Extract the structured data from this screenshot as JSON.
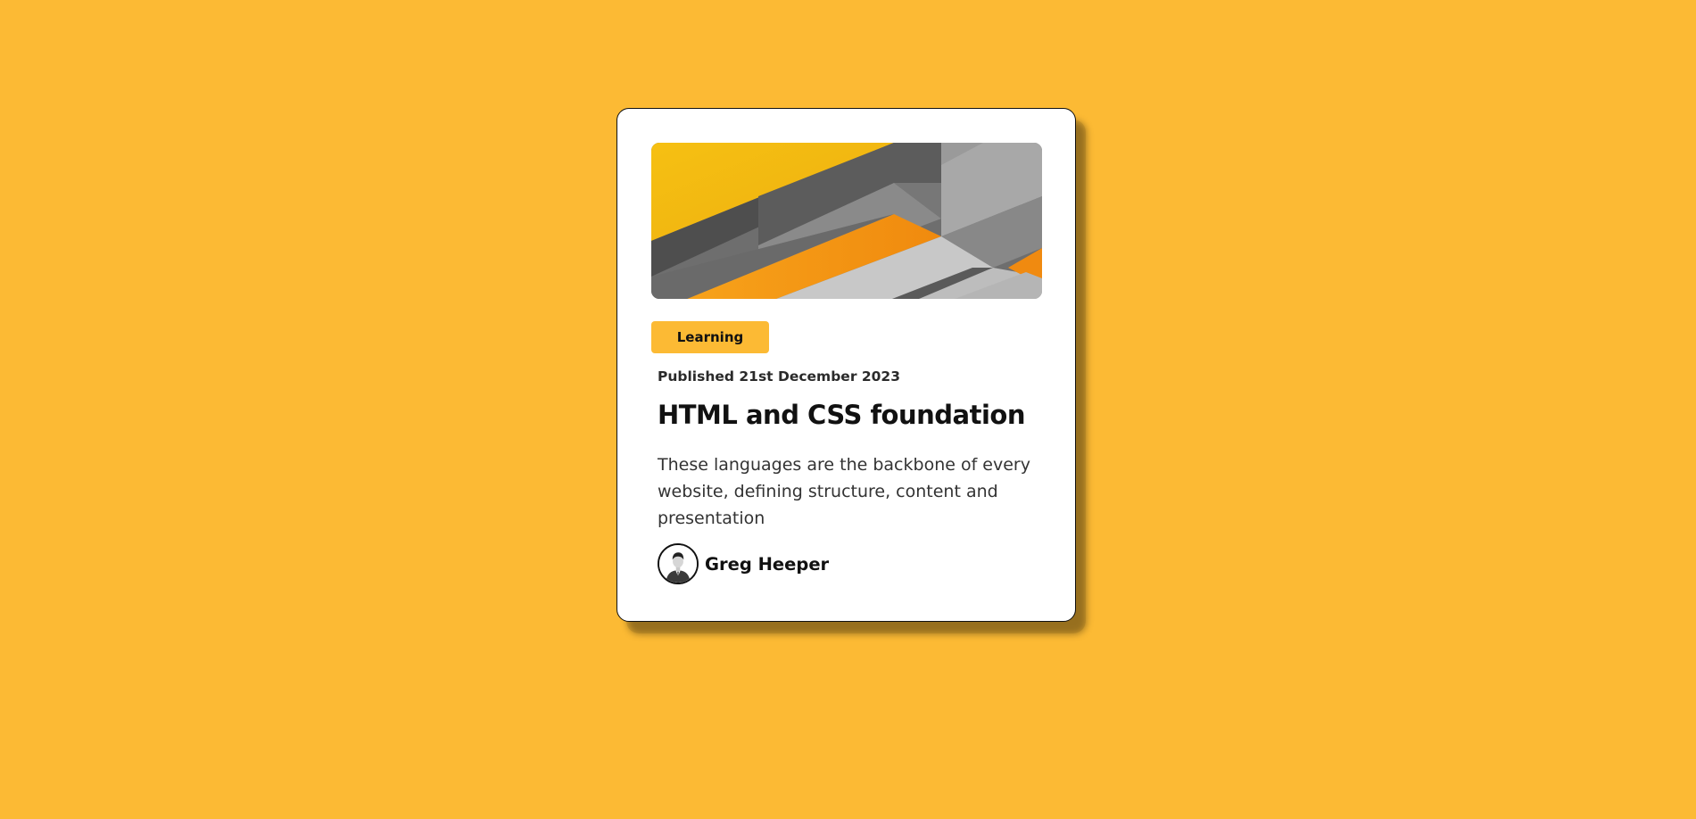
{
  "card": {
    "tag": "Learning",
    "published": "Published 21st December 2023",
    "title": "HTML and CSS foundation",
    "description": "These languages are the backbone of every website, defining structure, content and presentation",
    "author": {
      "name": "Greg Heeper",
      "avatar_icon": "person-in-suit-icon"
    },
    "hero_image": "abstract-geometric-image"
  },
  "colors": {
    "background": "#FCBA34",
    "card": "#FFFFFF",
    "tag": "#FCBA34",
    "text_dark": "#111111"
  }
}
